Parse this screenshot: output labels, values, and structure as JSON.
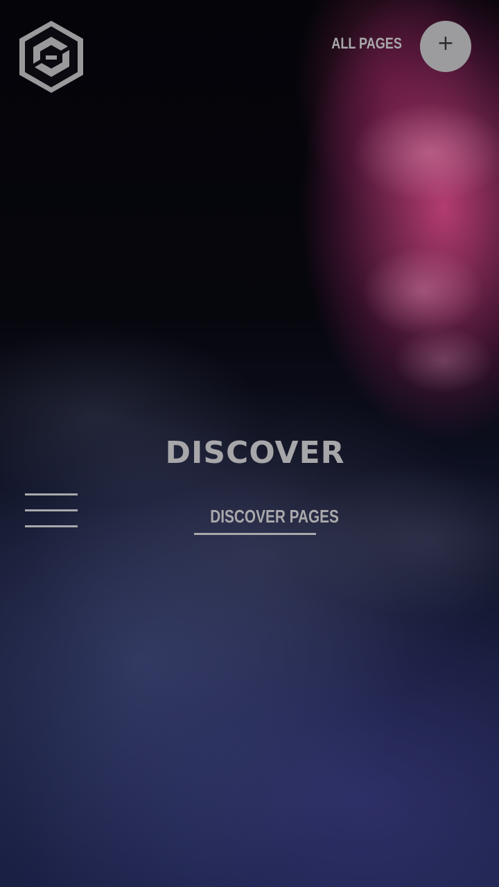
{
  "header": {
    "logo_icon": "hexagon-logo-icon",
    "all_pages_label": "ALL PAGES",
    "plus_button_glyph": "+"
  },
  "main": {
    "title": "DISCOVER",
    "sub_link_label": "DISCOVER PAGES",
    "menu_icon": "hamburger-menu-icon"
  },
  "colors": {
    "text": "#a9a9ac",
    "button_bg": "#9c9c9f",
    "accent_pink": "#d2467e",
    "accent_blue": "#3c3c82"
  }
}
